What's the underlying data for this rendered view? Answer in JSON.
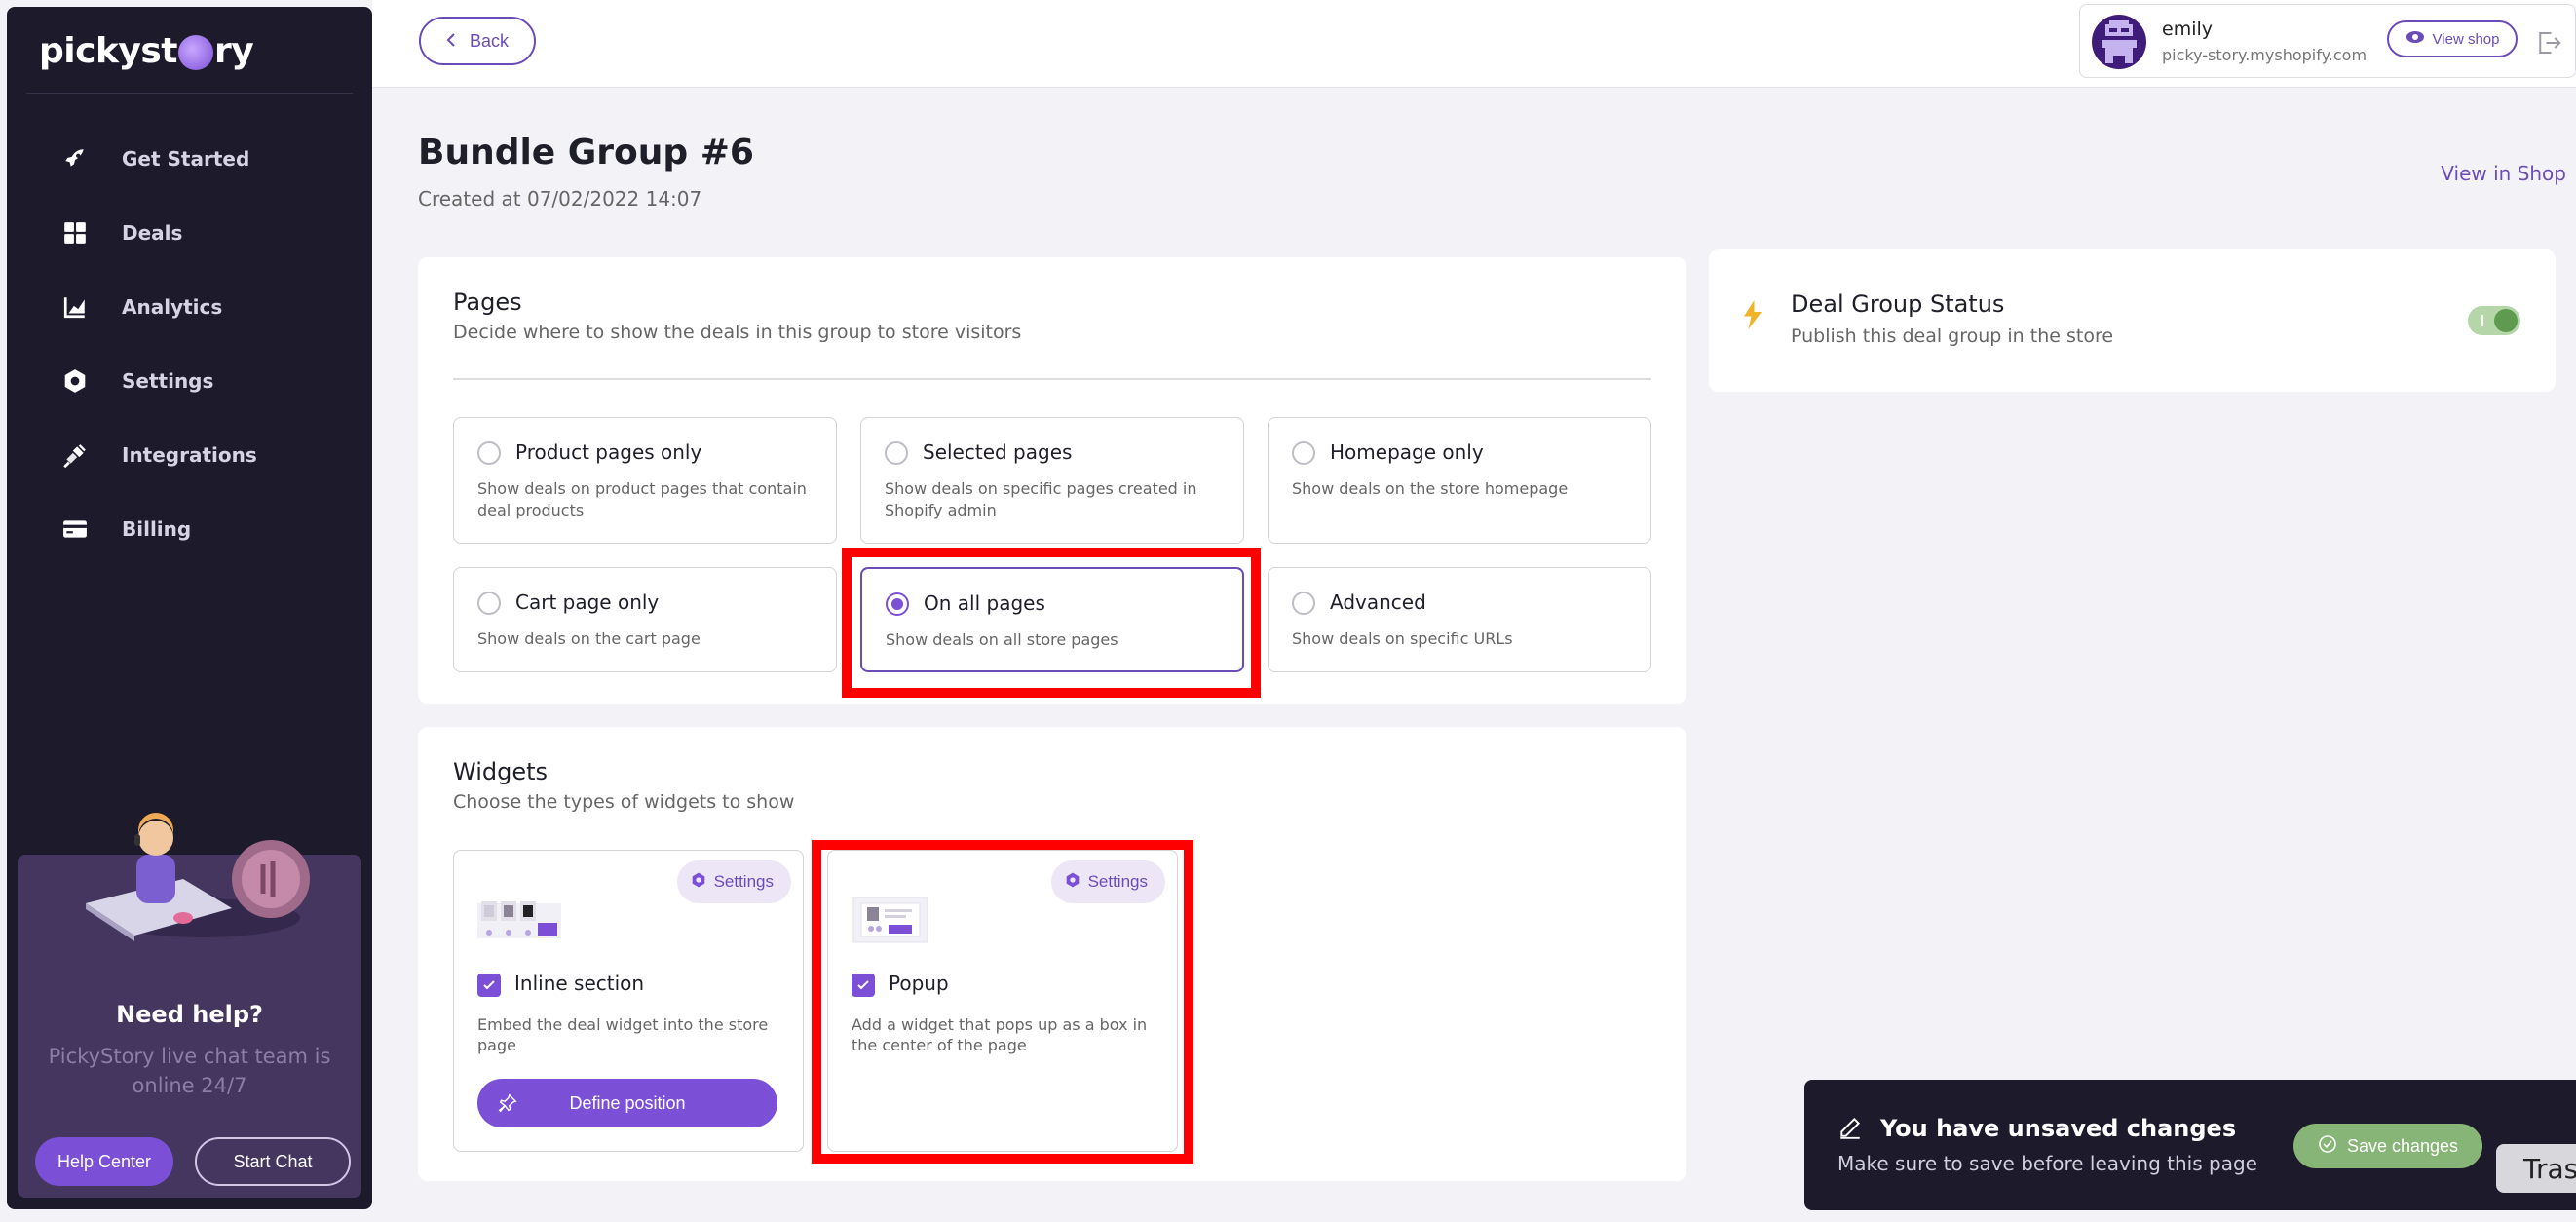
{
  "brand": {
    "logo_before": "pickyst",
    "logo_after": "ry"
  },
  "sidebar": {
    "items": [
      {
        "label": "Get Started",
        "icon": "rocket-icon"
      },
      {
        "label": "Deals",
        "icon": "grid-icon"
      },
      {
        "label": "Analytics",
        "icon": "chart-icon"
      },
      {
        "label": "Settings",
        "icon": "gear-icon"
      },
      {
        "label": "Integrations",
        "icon": "plug-icon"
      },
      {
        "label": "Billing",
        "icon": "card-icon"
      }
    ],
    "help": {
      "title": "Need help?",
      "description": "PickyStory live chat team is online 24/7",
      "help_center_label": "Help Center",
      "start_chat_label": "Start Chat"
    }
  },
  "topbar": {
    "back_label": "Back",
    "shop": {
      "name": "emily",
      "url": "picky-story.myshopify.com",
      "view_shop_label": "View shop"
    }
  },
  "page": {
    "title": "Bundle Group #6",
    "subtitle": "Created at 07/02/2022 14:07",
    "view_in_shop_label": "View in Shop"
  },
  "pages_card": {
    "title": "Pages",
    "description": "Decide where to show the deals in this group to store visitors",
    "options": [
      {
        "title": "Product pages only",
        "description": "Show deals on product pages that contain deal products",
        "selected": false
      },
      {
        "title": "Selected pages",
        "description": "Show deals on specific pages created in Shopify admin",
        "selected": false
      },
      {
        "title": "Homepage only",
        "description": "Show deals on the store homepage",
        "selected": false
      },
      {
        "title": "Cart page only",
        "description": "Show deals on the cart page",
        "selected": false
      },
      {
        "title": "On all pages",
        "description": "Show deals on all store pages",
        "selected": true
      },
      {
        "title": "Advanced",
        "description": "Show deals on specific URLs",
        "selected": false
      }
    ]
  },
  "widgets_card": {
    "title": "Widgets",
    "description": "Choose the types of widgets to show",
    "widgets": [
      {
        "title": "Inline section",
        "description": "Embed the deal widget into the store page",
        "settings_label": "Settings",
        "checked": true,
        "action_label": "Define position"
      },
      {
        "title": "Popup",
        "description": "Add a widget that pops up as a box in the center of the page",
        "settings_label": "Settings",
        "checked": true
      }
    ]
  },
  "status_card": {
    "title": "Deal Group Status",
    "description": "Publish this deal group in the store",
    "enabled": true
  },
  "unsaved_bar": {
    "title": "You have unsaved changes",
    "description": "Make sure to save before leaving this page",
    "save_label": "Save changes"
  },
  "tooltip_fragment": "Tras",
  "colors": {
    "accent": "#7b4fd6",
    "sidebar_bg": "#1d1b2b",
    "success": "#87b577",
    "highlight": "#ff0000"
  }
}
